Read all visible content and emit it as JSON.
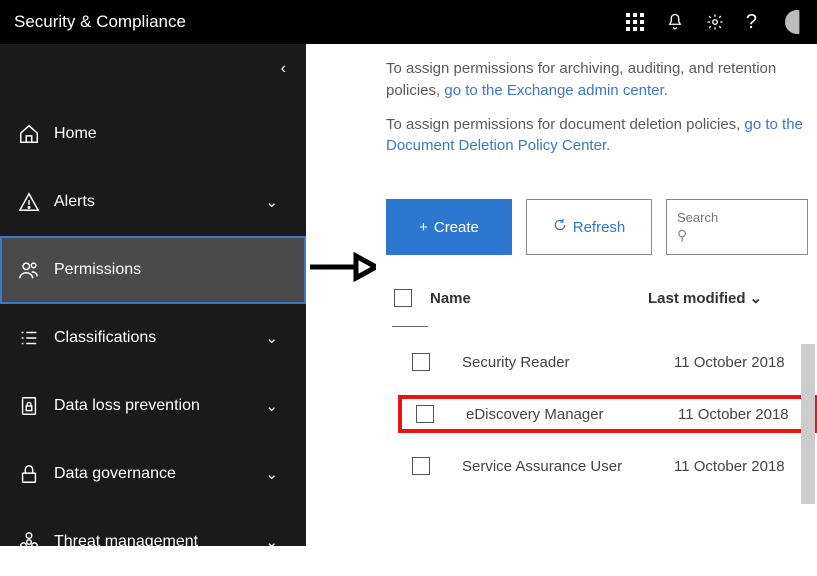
{
  "header": {
    "title": "Security & Compliance"
  },
  "sidebar": {
    "items": [
      {
        "label": "Home",
        "icon": "home",
        "expandable": false
      },
      {
        "label": "Alerts",
        "icon": "alert",
        "expandable": true
      },
      {
        "label": "Permissions",
        "icon": "people",
        "expandable": false,
        "active": true
      },
      {
        "label": "Classifications",
        "icon": "list",
        "expandable": true
      },
      {
        "label": "Data loss prevention",
        "icon": "lock-doc",
        "expandable": true
      },
      {
        "label": "Data governance",
        "icon": "lock",
        "expandable": true
      },
      {
        "label": "Threat management",
        "icon": "biohazard",
        "expandable": true
      }
    ]
  },
  "intro": {
    "line1_prefix": "To assign permissions for archiving, auditing, and retention policies, ",
    "line1_link": "go to the Exchange admin center",
    "line2_prefix": "To assign permissions for document deletion policies, ",
    "line2_link": "go to the Document Deletion Policy Center"
  },
  "actions": {
    "create_label": "Create",
    "refresh_label": "Refresh",
    "search_placeholder": "Search"
  },
  "table": {
    "columns": {
      "name": "Name",
      "modified": "Last modified"
    },
    "rows": [
      {
        "name": "Security Reader",
        "modified": "11 October 2018",
        "highlight": false
      },
      {
        "name": "eDiscovery Manager",
        "modified": "11 October 2018",
        "highlight": true
      },
      {
        "name": "Service Assurance User",
        "modified": "11 October 2018",
        "highlight": false
      }
    ]
  }
}
